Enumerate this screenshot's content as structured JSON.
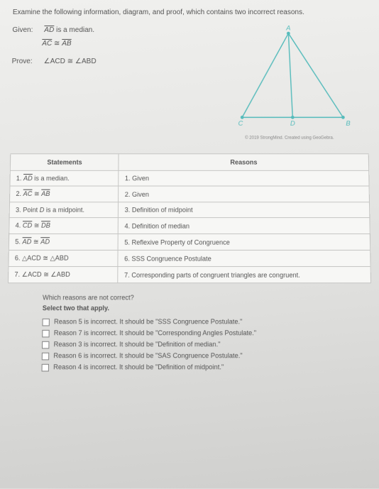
{
  "instruction": "Examine the following information, diagram, and proof, which contains two incorrect reasons.",
  "given_label": "Given:",
  "given_line1_pre": "AD",
  "given_line1_post": " is a median.",
  "given_line2_a": "AC",
  "given_line2_sym": " ≅ ",
  "given_line2_b": "AB",
  "prove_label": "Prove:",
  "prove_text": "∠ACD ≅ ∠ABD",
  "diagram": {
    "A": "A",
    "C": "C",
    "D": "D",
    "B": "B"
  },
  "attribution": "© 2019 StrongMind. Created using GeoGebra.",
  "table": {
    "h1": "Statements",
    "h2": "Reasons",
    "rows": [
      {
        "s_num": "1.",
        "s_a": "AD",
        "s_post": " is a median.",
        "r": "1. Given"
      },
      {
        "s_num": "2.",
        "s_a": "AC",
        "s_sym": " ≅ ",
        "s_b": "AB",
        "r": "2. Given"
      },
      {
        "s_num": "3. Point ",
        "s_i": "D",
        "s_post": " is a midpoint.",
        "r": "3. Definition of midpoint"
      },
      {
        "s_num": "4.",
        "s_a": "CD",
        "s_sym": " ≅ ",
        "s_b": "DB",
        "r": "4. Definition of median"
      },
      {
        "s_num": "5.",
        "s_a": "AD",
        "s_sym": " ≅ ",
        "s_b": "AD",
        "r": "5. Reflexive Property of Congruence"
      },
      {
        "s_plain": "6. △ACD ≅ △ABD",
        "r": "6. SSS Congruence Postulate"
      },
      {
        "s_plain": "7. ∠ACD ≅ ∠ABD",
        "r": "7. Corresponding parts of congruent triangles are congruent."
      }
    ]
  },
  "question": {
    "prompt": "Which reasons are not correct?",
    "sub": "Select two that apply.",
    "options": [
      "Reason 5 is incorrect. It should be \"SSS Congruence Postulate.\"",
      "Reason 7 is incorrect. It should be \"Corresponding Angles Postulate.\"",
      "Reason 3 is incorrect. It should be \"Definition of median.\"",
      "Reason 6 is incorrect. It should be \"SAS Congruence Postulate.\"",
      "Reason 4 is incorrect. It should be \"Definition of midpoint.\""
    ]
  }
}
